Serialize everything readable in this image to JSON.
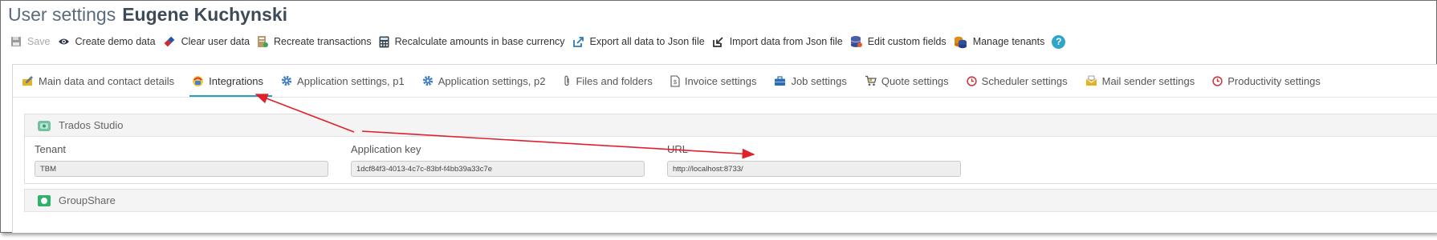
{
  "header": {
    "title_prefix": "User settings",
    "user_name": "Eugene Kuchynski"
  },
  "toolbar": {
    "items": [
      {
        "label": "Save",
        "icon": "floppy-disk-icon",
        "enabled": false
      },
      {
        "label": "Create demo data",
        "icon": "eye-icon",
        "enabled": true
      },
      {
        "label": "Clear user data",
        "icon": "eraser-icon",
        "enabled": true
      },
      {
        "label": "Recreate transactions",
        "icon": "ledger-icon",
        "enabled": true
      },
      {
        "label": "Recalculate amounts in base currency",
        "icon": "calculator-icon",
        "enabled": true
      },
      {
        "label": "Export all data to Json file",
        "icon": "export-icon",
        "enabled": true
      },
      {
        "label": "Import data from Json file",
        "icon": "import-icon",
        "enabled": true
      },
      {
        "label": "Edit custom fields",
        "icon": "database-icon",
        "enabled": true
      },
      {
        "label": "Manage tenants",
        "icon": "tenants-stack-icon",
        "enabled": true
      }
    ],
    "help": "?"
  },
  "tabs": [
    {
      "label": "Main data and contact details",
      "icon": "edit-folder-icon"
    },
    {
      "label": "Integrations",
      "icon": "integrations-icon",
      "active": true
    },
    {
      "label": "Application settings, p1",
      "icon": "gear-icon"
    },
    {
      "label": "Application settings, p2",
      "icon": "gear-icon"
    },
    {
      "label": "Files and folders",
      "icon": "paperclip-icon"
    },
    {
      "label": "Invoice settings",
      "icon": "invoice-icon"
    },
    {
      "label": "Job settings",
      "icon": "briefcase-icon"
    },
    {
      "label": "Quote settings",
      "icon": "cart-icon"
    },
    {
      "label": "Scheduler settings",
      "icon": "clock-icon"
    },
    {
      "label": "Mail sender settings",
      "icon": "mail-icon"
    },
    {
      "label": "Productivity settings",
      "icon": "clock-icon"
    }
  ],
  "integrations": {
    "trados": {
      "title": "Trados Studio",
      "fields": [
        {
          "label": "Tenant",
          "value": "TBM"
        },
        {
          "label": "Application key",
          "value": "1dcf84f3-4013-4c7c-83bf-f4bb39a33c7e"
        },
        {
          "label": "URL",
          "value": "http://localhost:8733/"
        }
      ]
    },
    "groupshare": {
      "title": "GroupShare"
    }
  },
  "colors": {
    "accent": "#2a9fb6",
    "annotation_arrow": "#e0202a"
  }
}
